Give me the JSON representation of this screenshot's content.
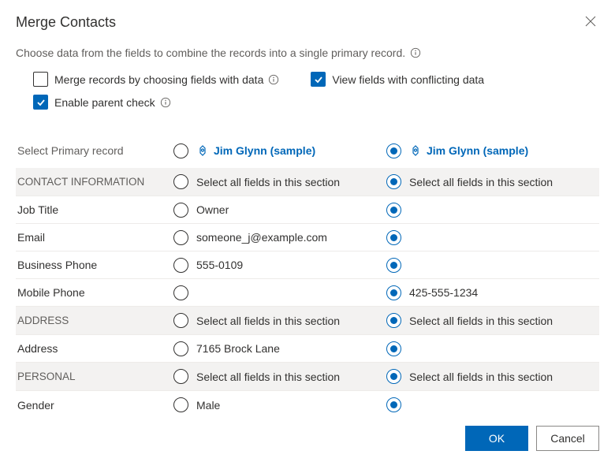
{
  "title": "Merge Contacts",
  "subtitle": "Choose data from the fields to combine the records into a single primary record.",
  "options": {
    "merge_by_fields": {
      "label": "Merge records by choosing fields with data",
      "checked": false
    },
    "view_conflicts": {
      "label": "View fields with conflicting data",
      "checked": true
    },
    "enable_parent": {
      "label": "Enable parent check",
      "checked": true
    }
  },
  "select_primary_label": "Select Primary record",
  "columns": {
    "left_contact": "Jim Glynn (sample)",
    "right_contact": "Jim Glynn (sample)"
  },
  "section_select_all": "Select all fields in this section",
  "sections": [
    {
      "key": "contact_info",
      "heading": "CONTACT INFORMATION",
      "rows": [
        {
          "label": "Job Title",
          "left": "Owner",
          "right": ""
        },
        {
          "label": "Email",
          "left": "someone_j@example.com",
          "right": ""
        },
        {
          "label": "Business Phone",
          "left": "555-0109",
          "right": ""
        },
        {
          "label": "Mobile Phone",
          "left": "",
          "right": "425-555-1234"
        }
      ]
    },
    {
      "key": "address",
      "heading": "ADDRESS",
      "rows": [
        {
          "label": "Address",
          "left": "7165 Brock Lane",
          "right": ""
        }
      ]
    },
    {
      "key": "personal",
      "heading": "PERSONAL",
      "rows": [
        {
          "label": "Gender",
          "left": "Male",
          "right": ""
        }
      ]
    }
  ],
  "buttons": {
    "ok": "OK",
    "cancel": "Cancel"
  }
}
